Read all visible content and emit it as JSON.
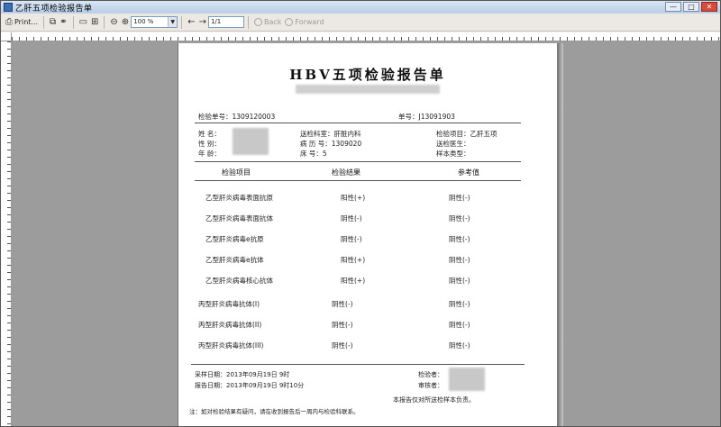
{
  "window": {
    "title": "乙肝五项检验报告单",
    "minimize": "—",
    "maximize": "□",
    "close": "✕"
  },
  "toolbar": {
    "print_label": "Print...",
    "zoom_value": "100 %",
    "page_value": "1/1",
    "back_label": "Back",
    "forward_label": "Forward"
  },
  "report": {
    "title": "HBV五项检验报告单",
    "header_id_left": "检验单号：1309120003 ",
    "header_id_right": "单号：J13091903",
    "info_left": [
      "姓    名：",
      "性    别：",
      "年    龄："
    ],
    "info_mid": [
      "送检科室：肝脏内科",
      "病 历 号：1309020",
      "床    号：5"
    ],
    "info_right": [
      "检验项目：乙肝五项",
      "送检医生：",
      "样本类型："
    ],
    "columns": [
      "检验项目",
      "检验结果",
      "参考值"
    ],
    "rows": [
      {
        "item": "乙型肝炎病毒表面抗原",
        "result": "阳性(+)",
        "ref": "阴性(-)"
      },
      {
        "item": "乙型肝炎病毒表面抗体",
        "result": "阴性(-)",
        "ref": "阴性(-)"
      },
      {
        "item": "乙型肝炎病毒e抗原",
        "result": "阴性(-)",
        "ref": "阴性(-)"
      },
      {
        "item": "乙型肝炎病毒e抗体",
        "result": "阳性(+)",
        "ref": "阴性(-)"
      },
      {
        "item": "乙型肝炎病毒核心抗体",
        "result": "阳性(+)",
        "ref": "阴性(-)"
      },
      {
        "item": "丙型肝炎病毒抗体(I)",
        "result": "阴性(-)",
        "ref": "阴性(-)"
      },
      {
        "item": "丙型肝炎病毒抗体(II)",
        "result": "阴性(-)",
        "ref": "阴性(-)"
      },
      {
        "item": "丙型肝炎病毒抗体(III)",
        "result": "阴性(-)",
        "ref": "阴性(-)"
      }
    ],
    "footer_date1": "采样日期：2013年09月19日 9时",
    "footer_date2": "报告日期：2013年09月19日 9时10分",
    "footer_check": "检验者：",
    "footer_review": "审核者：",
    "footer_note1": "本报告仅对所送检样本负责。",
    "footer_note2": "注：如对检验结果有疑问，请在收到报告后一周内与检验科联系。"
  }
}
